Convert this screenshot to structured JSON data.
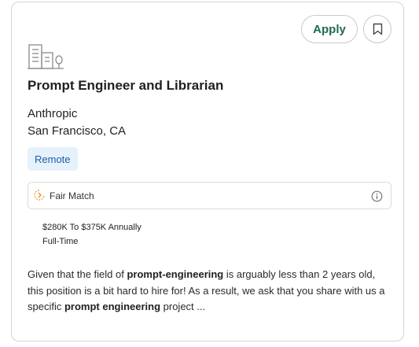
{
  "job": {
    "title": "Prompt Engineer and Librarian",
    "company": "Anthropic",
    "location": "San Francisco, CA",
    "work_mode": "Remote",
    "salary": "$280K To $375K Annually",
    "employment_type": "Full-Time"
  },
  "actions": {
    "apply_label": "Apply",
    "bookmark_icon": "bookmark-icon"
  },
  "match": {
    "label": "Fair Match",
    "icon": "match-indicator-icon",
    "info_icon": "info-icon"
  },
  "description": {
    "parts": [
      "Given that the field of ",
      "prompt-engineering",
      " is arguably less than 2 years old, this position is a bit hard to hire for! As a result, we ask that you share with us a specific ",
      "prompt engineering",
      " project ..."
    ]
  },
  "colors": {
    "accent_green": "#1f6b4f",
    "badge_bg": "#e5f1fb",
    "badge_text": "#1a5fa8",
    "match_orange": "#f0a24a"
  }
}
